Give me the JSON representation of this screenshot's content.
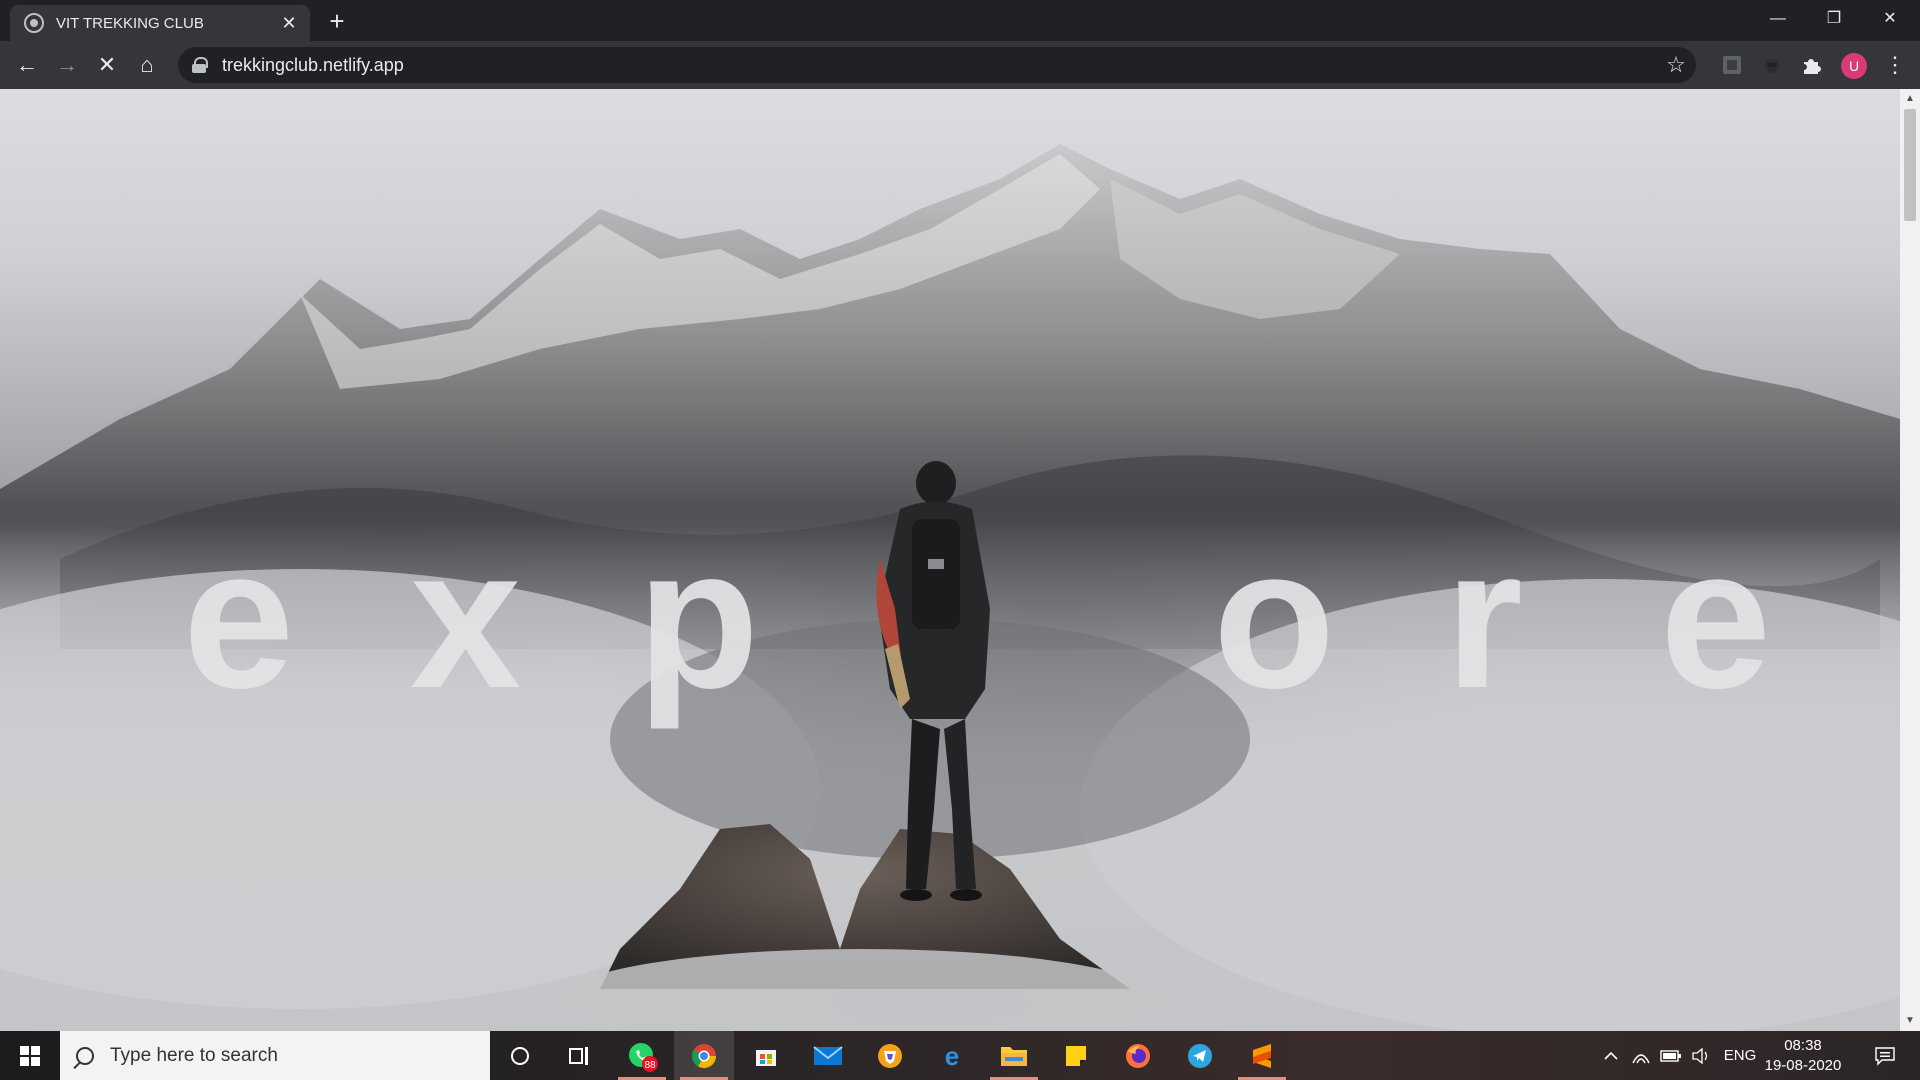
{
  "browser": {
    "tab_title": "VIT TREKKING CLUB",
    "tab_close": "✕",
    "new_tab": "+",
    "url": "trekkingclub.netlify.app",
    "avatar_initial": "U",
    "window_controls": {
      "minimize": "—",
      "restore": "❐",
      "close": "✕"
    },
    "nav": {
      "back": "←",
      "forward": "→",
      "stop": "✕",
      "home": "⌂",
      "star": "☆",
      "menu": "⋮"
    }
  },
  "page": {
    "hero_letters": [
      "e",
      "x",
      "p",
      "o",
      "r",
      "e"
    ]
  },
  "taskbar": {
    "search_placeholder": "Type here to search",
    "whatsapp_badge": "88",
    "language": "ENG",
    "time": "08:38",
    "date": "19-08-2020",
    "apps": [
      "cortana",
      "task-view",
      "whatsapp",
      "chrome",
      "microsoft-store",
      "mail",
      "brave",
      "edge",
      "file-explorer",
      "sticky-notes",
      "firefox",
      "telegram",
      "sublime-text"
    ]
  }
}
